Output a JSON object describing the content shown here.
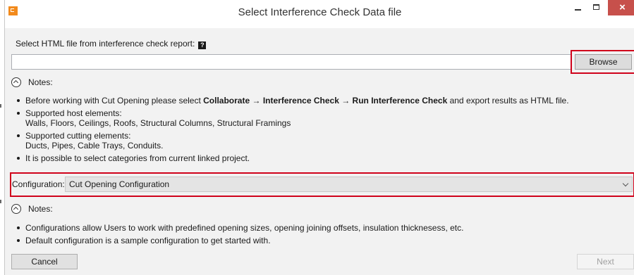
{
  "window": {
    "title": "Select Interference Check Data file",
    "close_glyph": "×",
    "app_icon": "app-logo-icon"
  },
  "file_section": {
    "label": "Select HTML file from interference check report:",
    "help_glyph": "?",
    "input_value": "",
    "browse_label": "Browse"
  },
  "notes1": {
    "label": "Notes:",
    "items": {
      "0": {
        "prefix": "Before working with Cut Opening please select ",
        "path": "Collaborate → Interference Check → Run Interference Check",
        "suffix": " and export results as HTML file."
      },
      "1": {
        "line1": "Supported host elements:",
        "line2": "Walls, Floors, Ceilings, Roofs, Structural Columns, Structural Framings"
      },
      "2": {
        "line1": "Supported cutting elements:",
        "line2": "Ducts, Pipes, Cable Trays, Conduits."
      },
      "3": {
        "text": "It is possible to select categories from current linked project."
      }
    }
  },
  "configuration": {
    "label": "Configuration:",
    "selected": "Cut Opening Configuration"
  },
  "notes2": {
    "label": "Notes:",
    "items": [
      "Configurations allow Users to work with predefined opening sizes, opening joining offsets, insulation thicknesess, etc.",
      "Default configuration is a sample configuration to get started with."
    ]
  },
  "footer": {
    "cancel_label": "Cancel",
    "next_label": "Next"
  },
  "colors": {
    "highlight": "#d0021b",
    "close_button": "#c7504b",
    "app_icon": "#f28a1c"
  }
}
